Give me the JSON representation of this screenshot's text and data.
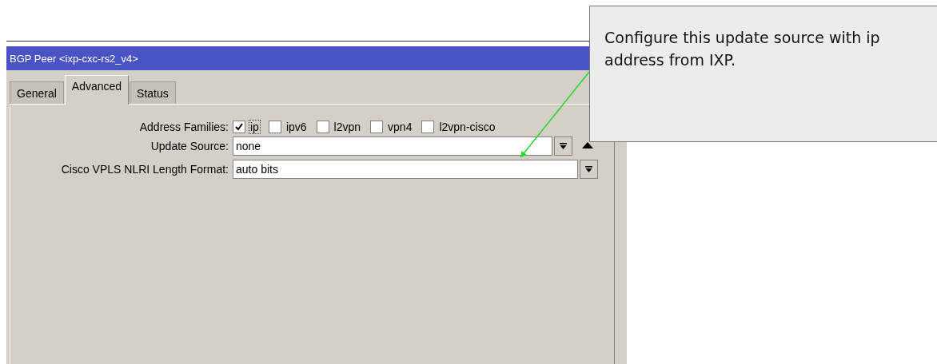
{
  "window": {
    "title": "BGP Peer <ixp-cxc-rs2_v4>"
  },
  "tabs": [
    {
      "label": "General",
      "selected": false
    },
    {
      "label": "Advanced",
      "selected": true
    },
    {
      "label": "Status",
      "selected": false
    }
  ],
  "fields": [
    {
      "kind": "checkboxes",
      "label": "Address Families:",
      "options": [
        {
          "label": "ip",
          "checked": true,
          "focused": true
        },
        {
          "label": "ipv6",
          "checked": false,
          "focused": false
        },
        {
          "label": "l2vpn",
          "checked": false,
          "focused": false
        },
        {
          "label": "vpn4",
          "checked": false,
          "focused": false
        },
        {
          "label": "l2vpn-cisco",
          "checked": false,
          "focused": false
        }
      ]
    },
    {
      "kind": "dropdown",
      "label": "Update Source:",
      "value": "none",
      "remove_button": true
    },
    {
      "kind": "dropdown",
      "label": "Cisco VPLS NLRI Length Format:",
      "value": "auto bits",
      "remove_button": false
    }
  ],
  "callout": {
    "text": "Configure this update source with ip address from IXP."
  }
}
